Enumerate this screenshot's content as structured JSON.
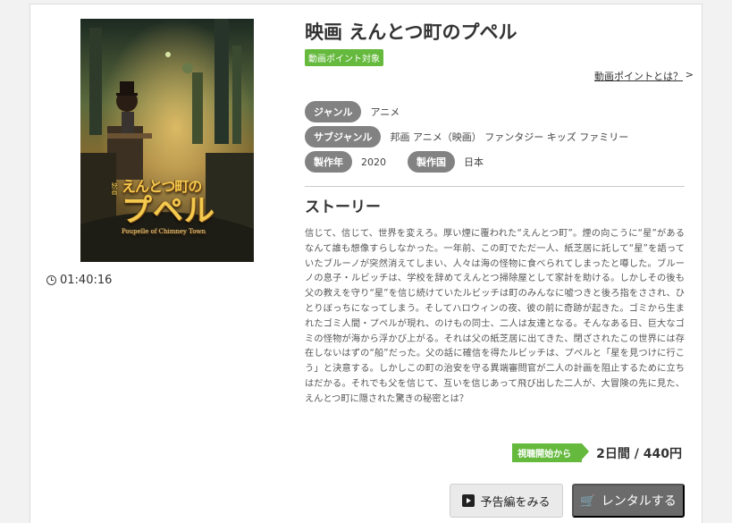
{
  "movie": {
    "title": "映画 えんとつ町のプペル",
    "points_badge": "動画ポイント対象",
    "points_link": "動画ポイントとは？",
    "points_arrow": ">",
    "duration": "01:40:16"
  },
  "poster": {
    "small_text": "えんとつ町の",
    "big_text": "プペル",
    "tiny_text": "Poupelle of Chimney Town",
    "mini_text": "映画"
  },
  "meta": {
    "genre_label": "ジャンル",
    "genre_value": "アニメ",
    "subgenre_label": "サブジャンル",
    "subgenre_value": "邦画 アニメ（映画） ファンタジー キッズ ファミリー",
    "year_label": "製作年",
    "year_value": "2020",
    "country_label": "製作国",
    "country_value": "日本"
  },
  "story": {
    "heading": "ストーリー",
    "text": "信じて、信じて、世界を変えろ。厚い煙に覆われた“えんとつ町”。煙の向こうに“星”があるなんて誰も想像すらしなかった。一年前、この町でただ一人、紙芝居に託して“星”を語っていたブルーノが突然消えてしまい、人々は海の怪物に食べられてしまったと噂した。ブルーノの息子・ルビッチは、学校を辞めてえんとつ掃除屋として家計を助ける。しかしその後も父の教えを守り“星”を信じ続けていたルビッチは町のみんなに嘘つきと後ろ指をさされ、ひとりぼっちになってしまう。そしてハロウィンの夜、彼の前に奇跡が起きた。ゴミから生まれたゴミ人間・プペルが現れ、のけもの同士、二人は友達となる。そんなある日、巨大なゴミの怪物が海から浮かび上がる。それは父の紙芝居に出てきた、閉ざされたこの世界には存在しないはずの“船”だった。父の話に確信を得たルビッチは、プペルと「星を見つけに行こう」と決意する。しかしこの町の治安を守る異端審問官が二人の計画を阻止するために立ちはだかる。それでも父を信じて、互いを信じあって飛び出した二人が、大冒険の先に見た、えんとつ町に隠された驚きの秘密とは？"
  },
  "pricing": {
    "tag": "視聴開始から",
    "price": "2日間 / 440円"
  },
  "buttons": {
    "trailer": "予告編をみる",
    "rent": "レンタルする"
  }
}
